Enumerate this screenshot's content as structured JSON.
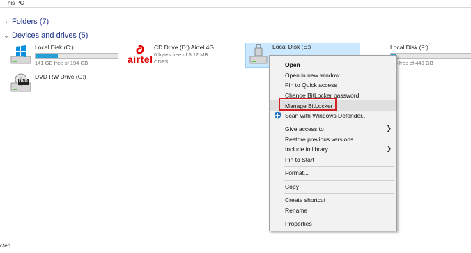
{
  "address": {
    "path": "This PC"
  },
  "groups": {
    "folders": {
      "label": "Folders (7)"
    },
    "devices": {
      "label": "Devices and drives (5)"
    }
  },
  "drives": [
    {
      "name": "Local Disk (C:)",
      "free_text": "141 GB free of 194 GB",
      "used_fraction": 0.27,
      "icon": "windows-drive-icon"
    },
    {
      "name": "CD Drive (D:) Airtel 4G",
      "free_text": "0 bytes free of 5.12 MB",
      "filesystem": "CDFS",
      "icon": "airtel-logo-icon",
      "logo_text": "airtel"
    },
    {
      "name": "Local Disk (E:)",
      "icon": "hard-drive-icon",
      "selected": true
    },
    {
      "name": "Local Disk (F:)",
      "free_text": "GB free of 443 GB",
      "used_fraction": 0.06,
      "icon": "hard-drive-icon"
    },
    {
      "name": "DVD RW Drive (G:)",
      "icon": "dvd-drive-icon",
      "badge": "DVD"
    }
  ],
  "context_menu": {
    "items": [
      {
        "label": "Open",
        "bold": true
      },
      {
        "label": "Open in new window"
      },
      {
        "label": "Pin to Quick access"
      },
      {
        "label": "Change BitLocker password"
      },
      {
        "label": "Manage BitLocker",
        "highlighted": true
      },
      {
        "label": "Scan with Windows Defender...",
        "icon": "windows-defender-icon"
      },
      {
        "label": "Give access to",
        "submenu": true
      },
      {
        "label": "Restore previous versions"
      },
      {
        "label": "Include in library",
        "submenu": true
      },
      {
        "label": "Pin to Start"
      },
      {
        "label": "Format..."
      },
      {
        "label": "Copy"
      },
      {
        "label": "Create shortcut"
      },
      {
        "label": "Rename"
      },
      {
        "label": "Properties"
      }
    ]
  },
  "status_bar": {
    "text": "cted"
  },
  "colors": {
    "accent": "#26a0da",
    "selection": "#cce8ff",
    "highlight_border": "#d32027",
    "group_header": "#1e3287"
  }
}
